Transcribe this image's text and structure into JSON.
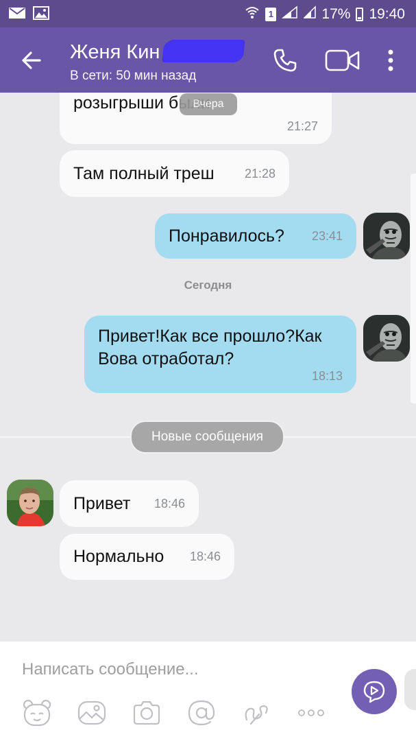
{
  "status_bar": {
    "battery": "17%",
    "time": "19:40",
    "sim_label": "1"
  },
  "header": {
    "contact_name": "Женя Кин",
    "contact_status": "В сети: 50 мин назад",
    "back_icon": "arrow-left-icon",
    "call_icon": "phone-icon",
    "video_icon": "video-camera-icon",
    "menu_icon": "more-vertical-icon"
  },
  "chat": {
    "yesterday_overlay": "Вчера",
    "messages": [
      {
        "direction": "incoming",
        "text": "розыгрыши были",
        "time": "21:27"
      },
      {
        "direction": "incoming",
        "text": "Там полный треш",
        "time": "21:28"
      },
      {
        "direction": "outgoing",
        "text": "Понравилось?",
        "time": "23:41"
      },
      {
        "direction": "outgoing",
        "text": "Привет!Как все прошло?Как Вова отработал?",
        "time": "18:13"
      },
      {
        "direction": "incoming",
        "text": "Привет",
        "time": "18:46"
      },
      {
        "direction": "incoming",
        "text": "Нормально",
        "time": "18:46"
      }
    ],
    "today_separator": "Сегодня",
    "new_messages_label": "Новые сообщения"
  },
  "composer": {
    "placeholder": "Написать сообщение...",
    "toolbar": [
      "sticker-bear-icon",
      "gallery-icon",
      "camera-icon",
      "mention-icon",
      "doodle-icon",
      "more-horizontal-icon"
    ],
    "send_icon": "send-bubble-icon"
  },
  "colors": {
    "status_bar": "#5d4b8e",
    "app_bar": "#6a56a6",
    "outgoing_bubble": "#a3dcf1",
    "incoming_bubble": "#fafafa",
    "chat_background": "#e9e8ea",
    "send_button": "#7360b5"
  }
}
